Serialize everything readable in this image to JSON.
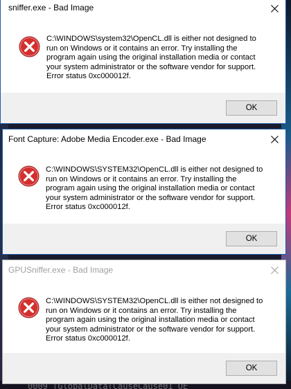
{
  "background": {
    "bottom_text": "0009  (GlobalData(CauseCause01  UE"
  },
  "dialogs": [
    {
      "title": "sniffer.exe - Bad Image",
      "message": "C:\\WINDOWS\\system32\\OpenCL.dll is either not designed to run on Windows or it contains an error. Try installing the program again using the original installation media or contact your system administrator or the software vendor for support. Error status 0xc000012f.",
      "ok_label": "OK",
      "state": "active"
    },
    {
      "title": "Font Capture: Adobe Media Encoder.exe - Bad Image",
      "message": "C:\\WINDOWS\\SYSTEM32\\OpenCL.dll is either not designed to run on Windows or it contains an error. Try installing the program again using the original installation media or contact your system administrator or the software vendor for support. Error status 0xc000012f.",
      "ok_label": "OK",
      "state": "active"
    },
    {
      "title": "GPUSniffer.exe - Bad Image",
      "message": "C:\\WINDOWS\\SYSTEM32\\OpenCL.dll is either not designed to run on Windows or it contains an error. Try installing the program again using the original installation media or contact your system administrator or the software vendor for support. Error status 0xc000012f.",
      "ok_label": "OK",
      "state": "inactive"
    }
  ],
  "icons": {
    "error": "error-icon",
    "close": "close-icon"
  },
  "colors": {
    "error_red": "#d32f2f",
    "accent": "#0078d7",
    "footer": "#f0f0f0"
  }
}
